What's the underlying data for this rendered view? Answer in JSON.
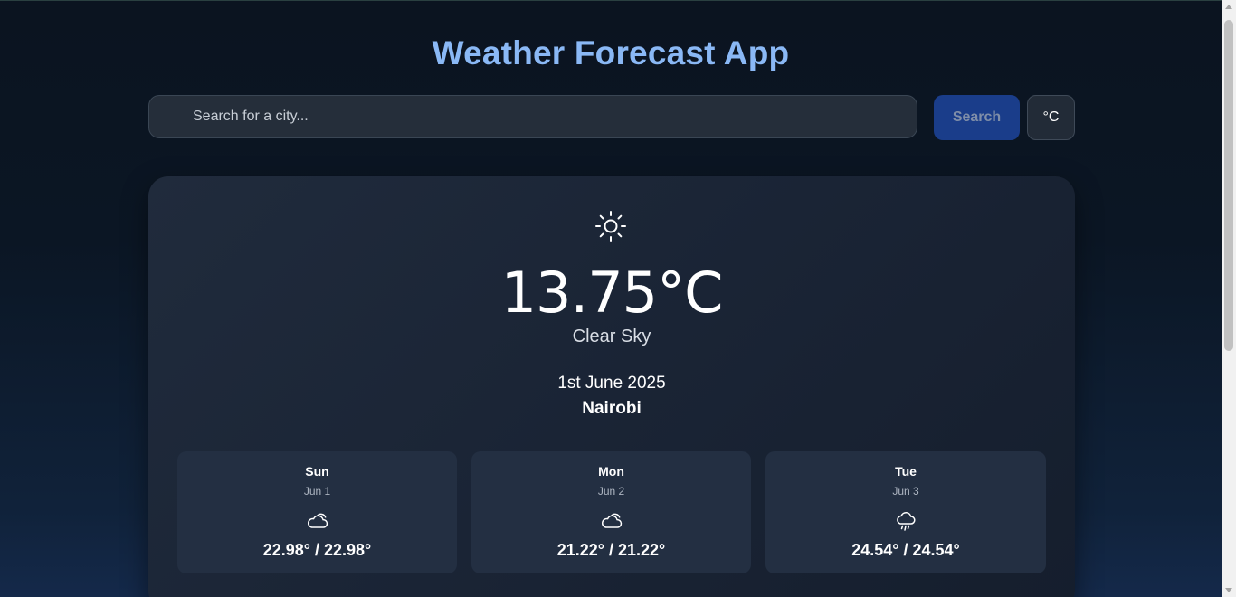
{
  "app": {
    "title": "Weather Forecast App"
  },
  "search": {
    "placeholder": "Search for a city...",
    "value": "",
    "button_label": "Search",
    "unit_label": "°C"
  },
  "current": {
    "icon": "sun-icon",
    "temperature": "13.75°C",
    "condition": "Clear Sky",
    "date": "1st June 2025",
    "city": "Nairobi"
  },
  "forecast": [
    {
      "day": "Sun",
      "date": "Jun 1",
      "icon": "cloud-icon",
      "temps": "22.98° / 22.98°"
    },
    {
      "day": "Mon",
      "date": "Jun 2",
      "icon": "cloud-icon",
      "temps": "21.22° / 21.22°"
    },
    {
      "day": "Tue",
      "date": "Jun 3",
      "icon": "rain-cloud-icon",
      "temps": "24.54° / 24.54°"
    }
  ],
  "colors": {
    "title": "#8ab8f5",
    "search_button": "#1a3d8a",
    "card_background": "#1a2435",
    "forecast_card_background": "#232f42"
  }
}
